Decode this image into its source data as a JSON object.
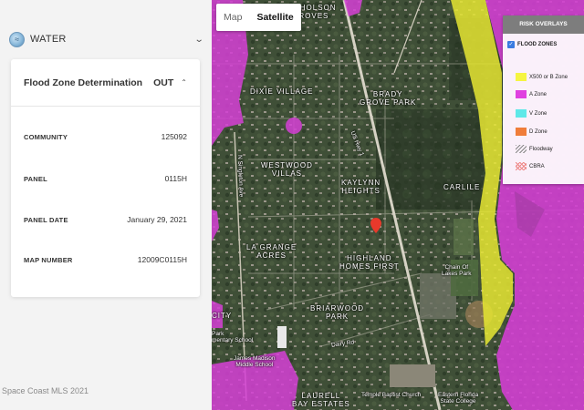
{
  "panel": {
    "section_title": "WATER",
    "card": {
      "title": "Flood Zone Determination",
      "status": "OUT",
      "rows": [
        {
          "key": "COMMUNITY",
          "value": "125092"
        },
        {
          "key": "PANEL",
          "value": "0115H"
        },
        {
          "key": "PANEL DATE",
          "value": "January 29, 2021"
        },
        {
          "key": "MAP NUMBER",
          "value": "12009C0115H"
        }
      ]
    },
    "footer": "Space Coast MLS 2021"
  },
  "map": {
    "toggle": {
      "map_label": "Map",
      "satellite_label": "Satellite",
      "active": "Satellite"
    },
    "overlay": {
      "title": "RISK OVERLAYS",
      "checkbox_label": "FLOOD ZONES",
      "checked": true,
      "legend": [
        {
          "label": "X500 or B Zone",
          "color": "#f5f542"
        },
        {
          "label": "A Zone",
          "color": "#e040e0"
        },
        {
          "label": "V Zone",
          "color": "#5fe8e8"
        },
        {
          "label": "D Zone",
          "color": "#f07d3a"
        },
        {
          "label": "Floodway",
          "color": "hatch-gray"
        },
        {
          "label": "CBRA",
          "color": "hatch-red"
        }
      ]
    },
    "labels": {
      "nicholson_groves": "NICHOLSON\nGROVES",
      "dixie_village": "DIXIE VILLAGE",
      "brady_grove_park": "BRADY\nGROVE PARK",
      "westwood_villas": "WESTWOOD\nVILLAS",
      "kaylynn_heights": "KAYLYNN\nHEIGHTS",
      "carlile": "CARLILE",
      "la_grange_acres": "LA GRANGE\nACRES",
      "highland_homes_first": "HIGHLAND\nHOMES FIRST",
      "briarwood_park": "BRIARWOOD\nPARK",
      "laurell_bay_estates": "LAURELL\nBAY ESTATES",
      "city": "CITY",
      "park_elementary": "Park\nmentary School",
      "james_madison": "James Madison\nMiddle School",
      "chain_of_lakes": "Chain Of\nLakes Park",
      "temple_baptist": "Temple Baptist Church",
      "eastern_florida": "Eastern Florida\nState College",
      "singleton_ave": "N Singleton Ave",
      "us_hwy_1": "US Hwy 1",
      "dairy_rd": "Dairy Rd"
    },
    "colors": {
      "a_zone": "#d63fd6",
      "x500": "#e6e633",
      "pin": "#e8392b"
    }
  }
}
